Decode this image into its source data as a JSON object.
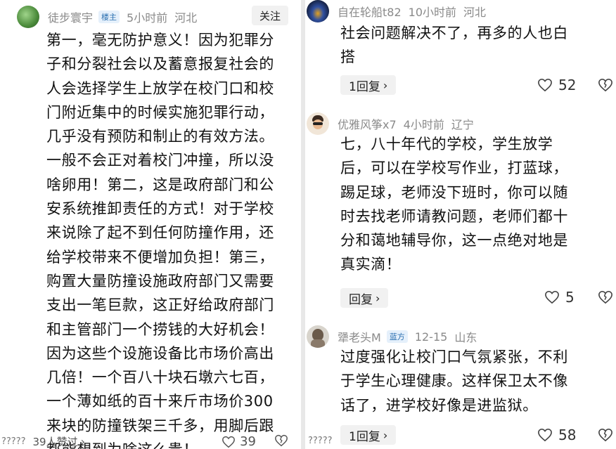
{
  "left": {
    "user": "徒步寰宇",
    "badge": "楼主",
    "time": "5小时前",
    "location": "河北",
    "follow": "关注",
    "lines": [
      "第一，毫无防护意义！因为犯罪分",
      "子和分裂社会以及蓄意报复社会的",
      "人会选择学生上放学在校门口和校",
      "门附近集中的时候实施犯罪行动，",
      "几乎没有预防和制止的有效方法。",
      "一般不会正对着校门冲撞，所以没",
      "啥卵用！第二，这是政府部门和公",
      "安系统推卸责任的方式！对于学校",
      "来说除了起不到任何防撞作用，还",
      "给学校带来不便增加负担！第三，",
      "购置大量防撞设施政府部门又需要",
      "支出一笔巨款，这正好给政府部门",
      "和主管部门一个捞钱的大好机会！",
      "因为这些个设施设备比市场价高出",
      "几倍！一个百八十块石墩六七百，",
      "一个薄如纸的百十来斤市场价300",
      "来块的防撞铁架三千多，用脚后跟",
      "都能想到为啥这么贵！"
    ],
    "footer_prefix": "?????",
    "liked_by": "39人赞过",
    "likes": "39"
  },
  "comments": [
    {
      "user": "自在轮船t82",
      "time": "10小时前",
      "location": "河北",
      "lines": [
        "社会问题解决不了，再多的人也白",
        "搭"
      ],
      "reply": "1回复",
      "likes": "52"
    },
    {
      "user": "优雅风筝x7",
      "time": "4小时前",
      "location": "辽宁",
      "lines": [
        "七，八十年代的学校，学生放学",
        "后，可以在学校写作业，打蓝球，",
        "踢足球，老师没下班时，你可以随",
        "时去找老师请教问题，老师们都十",
        "分和蔼地辅导你，这一点绝对地是",
        "真实滴！"
      ],
      "reply": "回复",
      "likes": "5"
    },
    {
      "user": "犟老头M",
      "badge": "蓝方",
      "time": "12-15",
      "location": "山东",
      "lines": [
        "过度强化让校门口气氛紧张，不利",
        "于学生心理健康。这样保卫太不像",
        "话了，进学校好像是进监狱。"
      ],
      "reply": "1回复",
      "likes": "58"
    }
  ],
  "right_footer_prefix": "?????"
}
